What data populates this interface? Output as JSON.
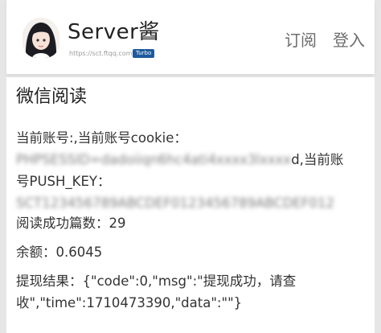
{
  "header": {
    "brand_name": "Server酱",
    "brand_url": "https://sct.ftqq.com",
    "brand_badge": "Turbo",
    "nav": [
      {
        "label": "订阅"
      },
      {
        "label": "登入"
      }
    ]
  },
  "content": {
    "title": "微信阅读",
    "account_line_1": "当前账号:,当前账号cookie：",
    "account_line_2_blur": "PHPSESSID=dadoiiqn6hc4ati4xxxx3lxxxx",
    "account_line_2_tail": "d,当前账",
    "account_line_3": "号PUSH_KEY：",
    "account_line_4_blur": "SCT123456789ABCDEF0123456789ABCDEF012",
    "read_count": "阅读成功篇数：29",
    "balance": "余额：0.6045",
    "withdraw_line_1": "提现结果：{\"code\":0,\"msg\":\"提现成功，请查",
    "withdraw_line_2": "收\",\"time\":1710473390,\"data\":\"\"}"
  }
}
